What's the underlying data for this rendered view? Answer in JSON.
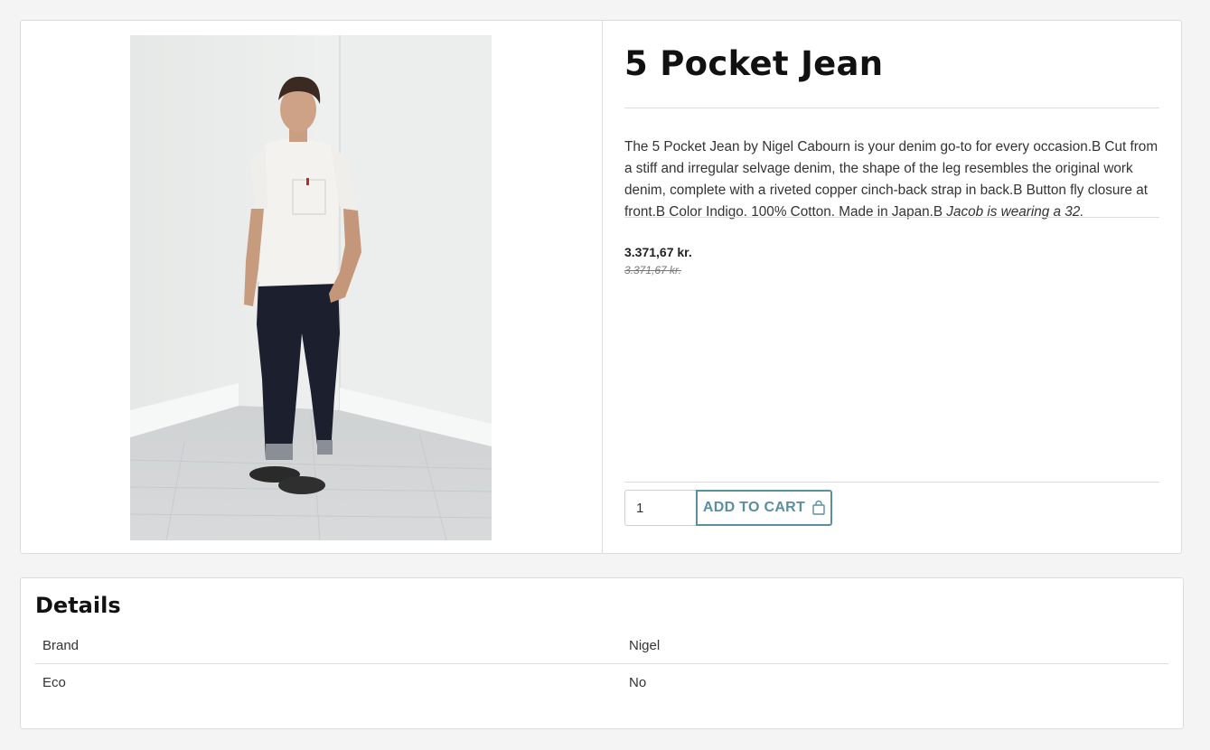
{
  "product": {
    "title": "5 Pocket Jean",
    "description_text": "The 5 Pocket Jean by Nigel Cabourn is your denim go-to for every occasion.B Cut from a stiff and irregular selvage denim, the shape of the leg resembles the original work denim, complete with a riveted copper cinch-back strap in back.B Button fly closure at front.B Color Indigo. 100% Cotton. Made in Japan.B ",
    "description_italic": "Jacob is wearing a 32.",
    "price": "3.371,67 kr.",
    "old_price": "3.371,67 kr.",
    "quantity": "1",
    "add_to_cart_label": "ADD TO CART",
    "cart_icon": "shopping-bag-icon"
  },
  "details": {
    "title": "Details",
    "rows": [
      {
        "label": "Brand",
        "value": "Nigel"
      },
      {
        "label": "Eco",
        "value": "No"
      }
    ]
  },
  "colors": {
    "accent": "#5a8fa0",
    "background": "#f4f4f4",
    "denim": "#1b1f2e"
  }
}
